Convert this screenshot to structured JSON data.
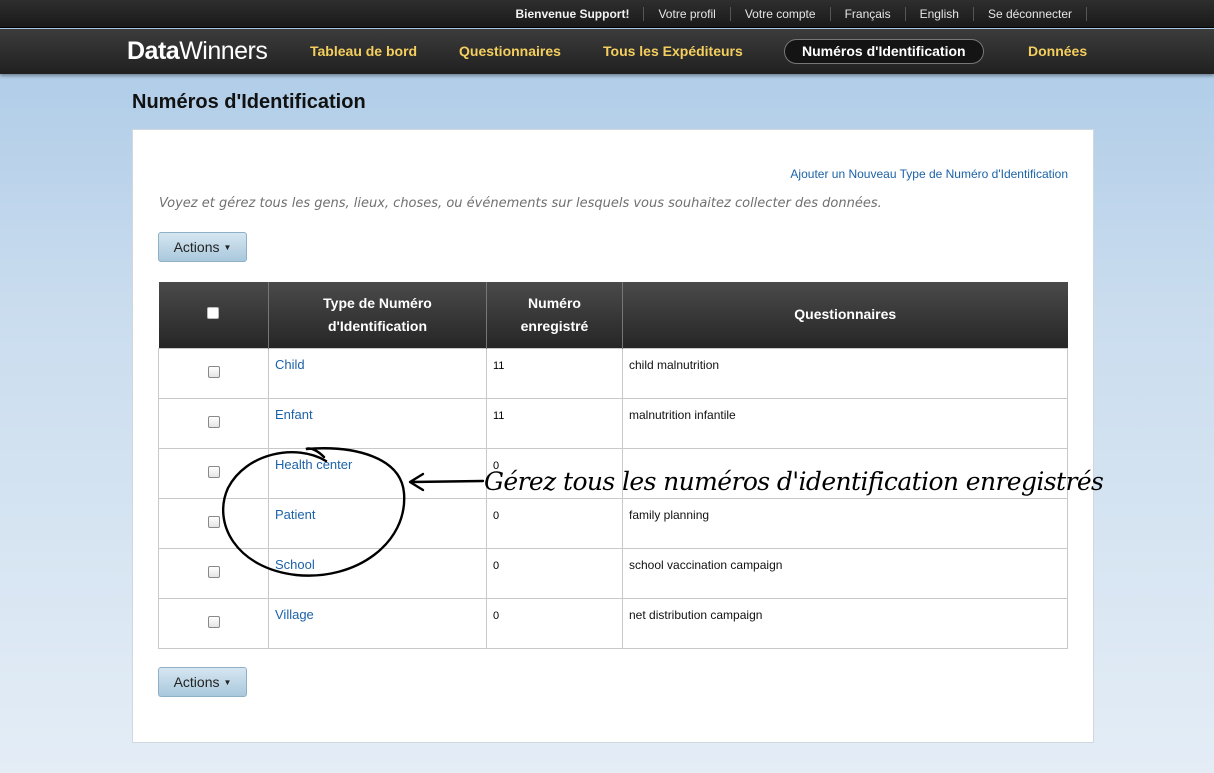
{
  "topbar": {
    "welcome": "Bienvenue Support!",
    "links": [
      "Votre profil",
      "Votre compte",
      "Français",
      "English",
      "Se déconnecter"
    ]
  },
  "brand": {
    "part1": "Data",
    "part2": "Winners"
  },
  "nav": {
    "items": [
      {
        "label": "Tableau de bord",
        "active": false
      },
      {
        "label": "Questionnaires",
        "active": false
      },
      {
        "label": "Tous les Expéditeurs",
        "active": false
      },
      {
        "label": "Numéros d'Identification",
        "active": true
      },
      {
        "label": "Données",
        "active": false
      }
    ]
  },
  "page": {
    "title": "Numéros d'Identification",
    "add_link": "Ajouter un Nouveau Type de Numéro d'Identification",
    "intro": "Voyez et gérez tous les gens, lieux, choses, ou événements sur lesquels vous souhaitez collecter des données.",
    "actions_label": "Actions"
  },
  "table": {
    "headers": {
      "type_line1": "Type de Numéro",
      "type_line2": "d'Identification",
      "count_line1": "Numéro",
      "count_line2": "enregistré",
      "questionnaires": "Questionnaires"
    },
    "rows": [
      {
        "name": "Child",
        "count": "11",
        "questionnaires": "child malnutrition"
      },
      {
        "name": "Enfant",
        "count": "11",
        "questionnaires": "malnutrition infantile"
      },
      {
        "name": "Health center",
        "count": "0",
        "questionnaires": ""
      },
      {
        "name": "Patient",
        "count": "0",
        "questionnaires": "family planning"
      },
      {
        "name": "School",
        "count": "0",
        "questionnaires": "school vaccination campaign"
      },
      {
        "name": "Village",
        "count": "0",
        "questionnaires": "net distribution campaign"
      }
    ]
  },
  "annotation": {
    "text": "Gérez tous les numéros d'identification enregistrés"
  },
  "colors": {
    "nav_link": "#f5cf5e",
    "link": "#1c62a8",
    "background_top": "#a9c8e6"
  }
}
